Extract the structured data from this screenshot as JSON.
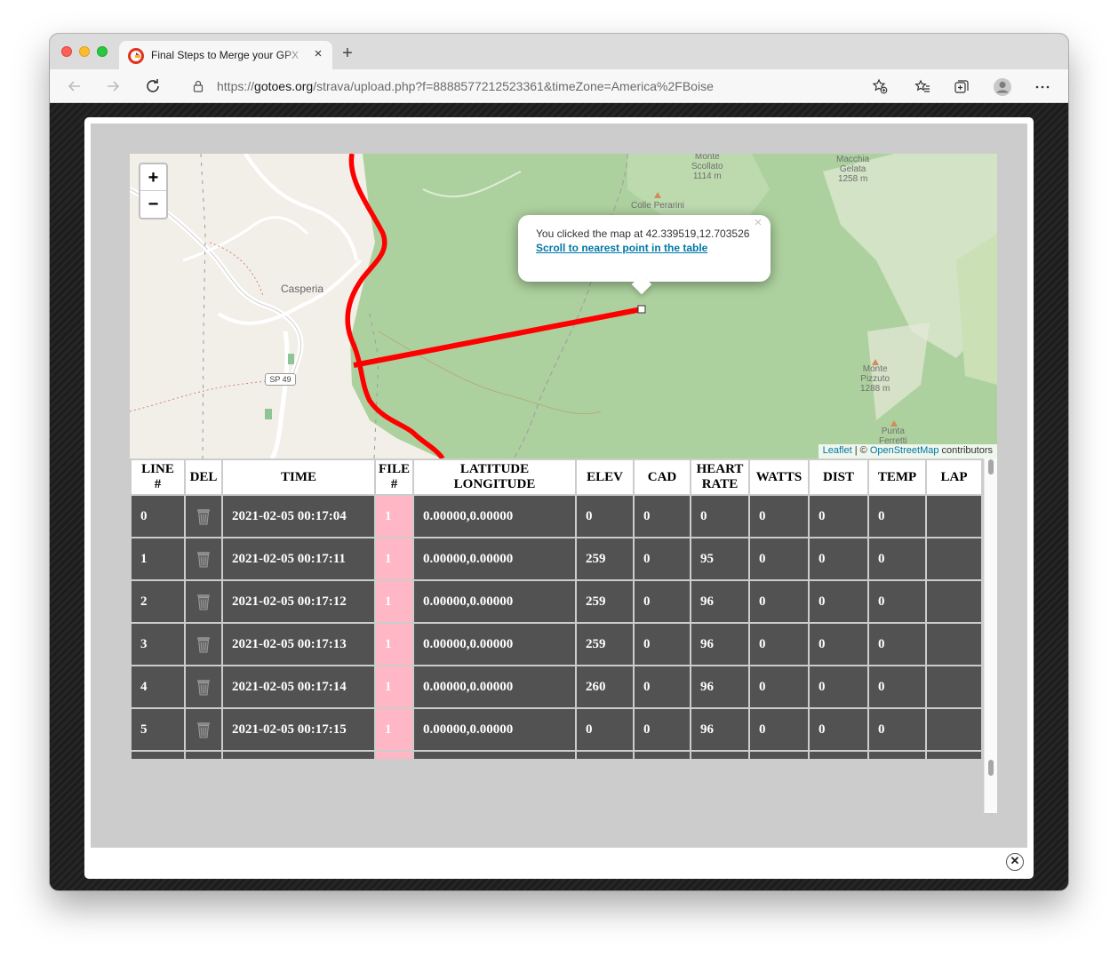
{
  "browser": {
    "tab_title": "Final Steps to Merge your GPX",
    "tab_close": "×",
    "new_tab": "+",
    "url_prefix": "https://",
    "url_host": "gotoes.org",
    "url_path": "/strava/upload.php?f=8888577212523361&timeZone=America%2FBoise"
  },
  "map": {
    "zoom_in": "+",
    "zoom_out": "−",
    "popup_text": "You clicked the map at 42.339519,12.703526",
    "popup_link": "Scroll to nearest point in the table",
    "popup_close": "×",
    "attribution_leaflet": "Leaflet",
    "attribution_sep": " | © ",
    "attribution_osm": "OpenStreetMap",
    "attribution_tail": " contributors",
    "labels": {
      "monte_scollato": [
        "Monte",
        "Scollato",
        "1114 m"
      ],
      "macchia_gelata": [
        "Macchia",
        "Gelata",
        "1258 m"
      ],
      "colle_perarini": "Colle Perarini",
      "casperia": "Casperia",
      "sp49": "SP 49",
      "monte_pizzuto": [
        "Monte",
        "Pizzuto",
        "1288 m"
      ],
      "punta_ferretti": [
        "Punta",
        "Ferretti"
      ]
    }
  },
  "table": {
    "headers": [
      [
        "LINE",
        "#"
      ],
      [
        "DEL"
      ],
      [
        "TIME"
      ],
      [
        "FILE",
        "#"
      ],
      [
        "LATITUDE",
        "LONGITUDE"
      ],
      [
        "ELEV"
      ],
      [
        "CAD"
      ],
      [
        "HEART",
        "RATE"
      ],
      [
        "WATTS"
      ],
      [
        "DIST"
      ],
      [
        "TEMP"
      ],
      [
        "LAP"
      ]
    ],
    "rows": [
      [
        "0",
        "2021-02-05 00:17:04",
        "1",
        "0.00000,0.00000",
        "0",
        "0",
        "0",
        "0",
        "0",
        "0",
        ""
      ],
      [
        "1",
        "2021-02-05 00:17:11",
        "1",
        "0.00000,0.00000",
        "259",
        "0",
        "95",
        "0",
        "0",
        "0",
        ""
      ],
      [
        "2",
        "2021-02-05 00:17:12",
        "1",
        "0.00000,0.00000",
        "259",
        "0",
        "96",
        "0",
        "0",
        "0",
        ""
      ],
      [
        "3",
        "2021-02-05 00:17:13",
        "1",
        "0.00000,0.00000",
        "259",
        "0",
        "96",
        "0",
        "0",
        "0",
        ""
      ],
      [
        "4",
        "2021-02-05 00:17:14",
        "1",
        "0.00000,0.00000",
        "260",
        "0",
        "96",
        "0",
        "0",
        "0",
        ""
      ],
      [
        "5",
        "2021-02-05 00:17:15",
        "1",
        "0.00000,0.00000",
        "0",
        "0",
        "96",
        "0",
        "0",
        "0",
        ""
      ],
      [
        "",
        "",
        "",
        "",
        "",
        "",
        "",
        "",
        "",
        "",
        ""
      ]
    ]
  },
  "modal": {
    "close": "✕"
  },
  "colors": {
    "track": "#ff0000",
    "row_bg": "#525252",
    "file_cell": "#ffb7c5",
    "link": "#0078a8"
  }
}
